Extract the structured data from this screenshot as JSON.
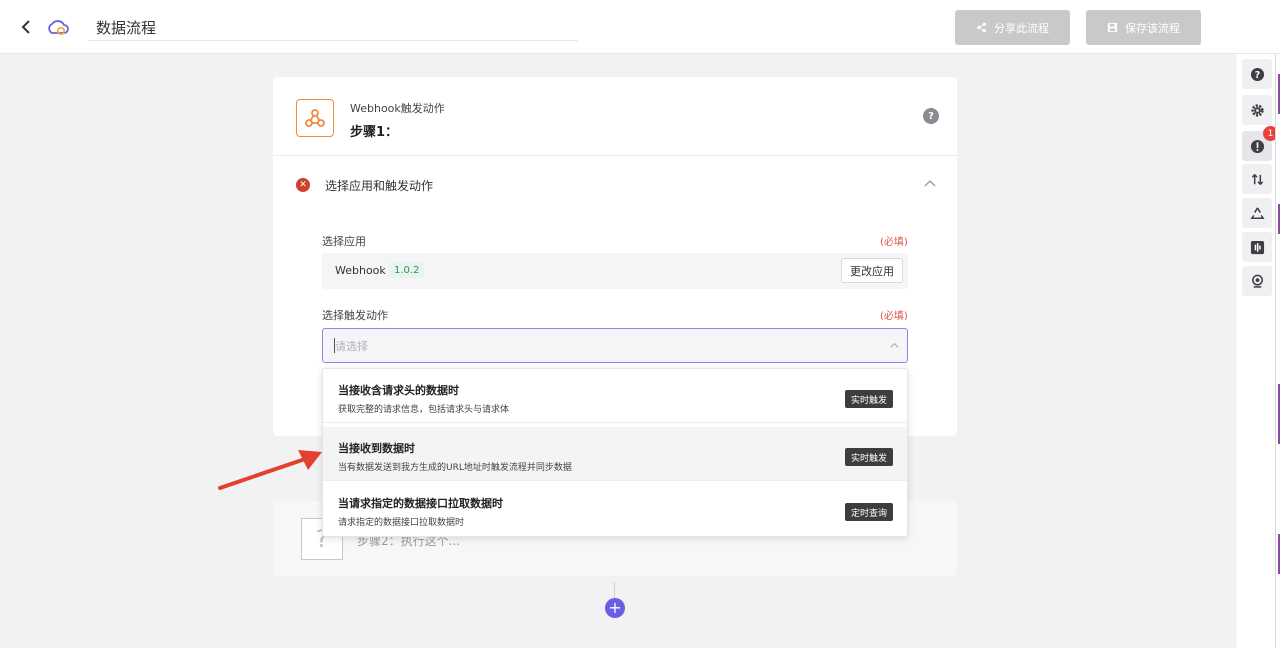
{
  "header": {
    "title": "数据流程",
    "share_label": "分享此流程",
    "save_label": "保存该流程"
  },
  "rail": {
    "alert_count": "1",
    "icons": [
      "help-icon",
      "gear-icon",
      "alert-icon",
      "sort-icon",
      "recycle-icon",
      "audio-icon",
      "webcam-icon"
    ]
  },
  "step1": {
    "trigger_label": "Webhook触发动作",
    "title": "步骤1：",
    "section_title": "选择应用和触发动作",
    "app_field_label": "选择应用",
    "required_label": "(必填)",
    "app_name": "Webhook",
    "app_version": "1.0.2",
    "change_app_label": "更改应用",
    "action_field_label": "选择触发动作",
    "action_placeholder": "请选择"
  },
  "dropdown": {
    "options": [
      {
        "title": "当接收含请求头的数据时",
        "desc": "获取完整的请求信息，包括请求头与请求体",
        "tag": "实时触发"
      },
      {
        "title": "当接收到数据时",
        "desc": "当有数据发送到我方生成的URL地址时触发流程并同步数据",
        "tag": "实时触发"
      },
      {
        "title": "当请求指定的数据接口拉取数据时",
        "desc": "请求指定的数据接口拉取数据时",
        "tag": "定时查询"
      }
    ]
  },
  "step2": {
    "placeholder": "步骤2：执行这个..."
  },
  "colors": {
    "accent": "#6a5ee6",
    "error": "#d0402e",
    "required": "#e0524b",
    "webhook_orange": "#f08a3c",
    "arrow_red": "#e2412f"
  }
}
